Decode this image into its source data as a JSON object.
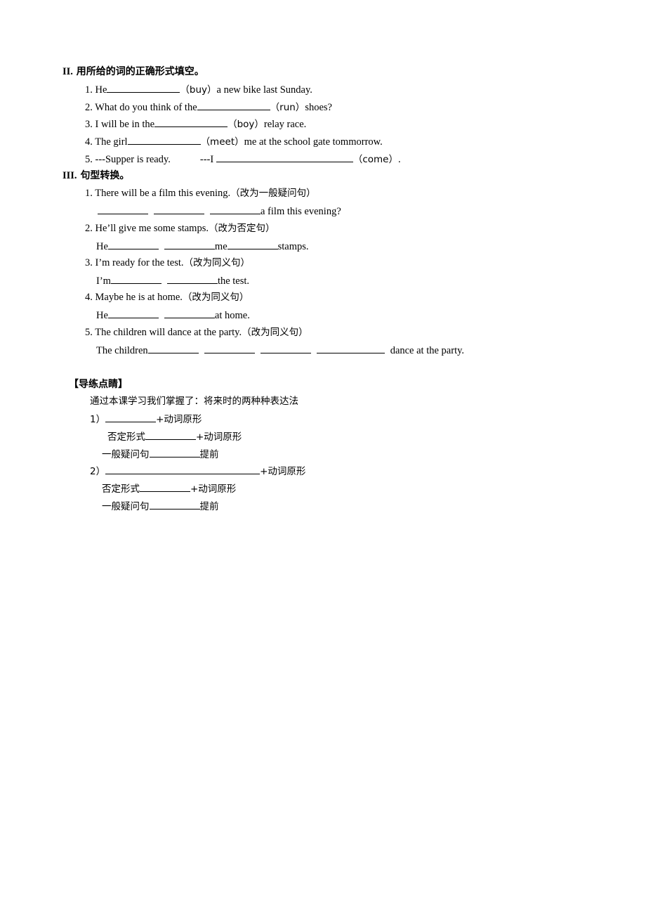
{
  "section2": {
    "title_num": "II.",
    "title_text": "用所给的词的正确形式填空。",
    "items": [
      {
        "num": "1.",
        "before": "He",
        "hint": "（buy）",
        "after": "a new bike last Sunday."
      },
      {
        "num": "2.",
        "before": "What do you think of the",
        "hint": "（run）",
        "after": "shoes?"
      },
      {
        "num": "3.",
        "before": "I will be in the",
        "hint": "（boy）",
        "after": "relay race."
      },
      {
        "num": "4.",
        "before": "The girl",
        "hint": "（meet）",
        "after": "me at the school gate tommorrow."
      },
      {
        "num": "5.",
        "before": "---Supper is ready.",
        "mid": "---I",
        "hint": "（come）",
        "after": "."
      }
    ]
  },
  "section3": {
    "title_num": "III.",
    "title_text": "句型转换。",
    "items": [
      {
        "num": "1.",
        "sentence": "There will be a film this evening.",
        "instruction": "（改为一般疑问句）",
        "answer_after": "a film this evening?"
      },
      {
        "num": "2.",
        "sentence": "He’ll give me some stamps.",
        "instruction": "（改为否定句）",
        "answer_start": "He",
        "answer_mid": "me",
        "answer_after": "stamps."
      },
      {
        "num": "3.",
        "sentence": "I’m ready for the test.",
        "instruction": "（改为同义句）",
        "answer_start": "I’m",
        "answer_after": "the test."
      },
      {
        "num": "4.",
        "sentence": "Maybe he is at home.",
        "instruction": "（改为同义句）",
        "answer_start": "He",
        "answer_after": "at home."
      },
      {
        "num": "5.",
        "sentence": "The children will dance at the party.",
        "instruction": "（改为同义句）",
        "answer_start": "The children",
        "answer_after": "dance at the party."
      }
    ]
  },
  "guide": {
    "title": "【导练点睛】",
    "intro": "通过本课学习我们掌握了：将来时的两种种表达法",
    "form1": {
      "label": "1）",
      "suffix": "+动词原形",
      "neg_label": "否定形式",
      "neg_suffix": "+动词原形",
      "q_label": "一般疑问句",
      "q_suffix": "提前"
    },
    "form2": {
      "label": "2）",
      "suffix": "+动词原形",
      "neg_label": "否定形式",
      "neg_suffix": "+动词原形",
      "q_label": "一般疑问句",
      "q_suffix": "提前"
    }
  }
}
